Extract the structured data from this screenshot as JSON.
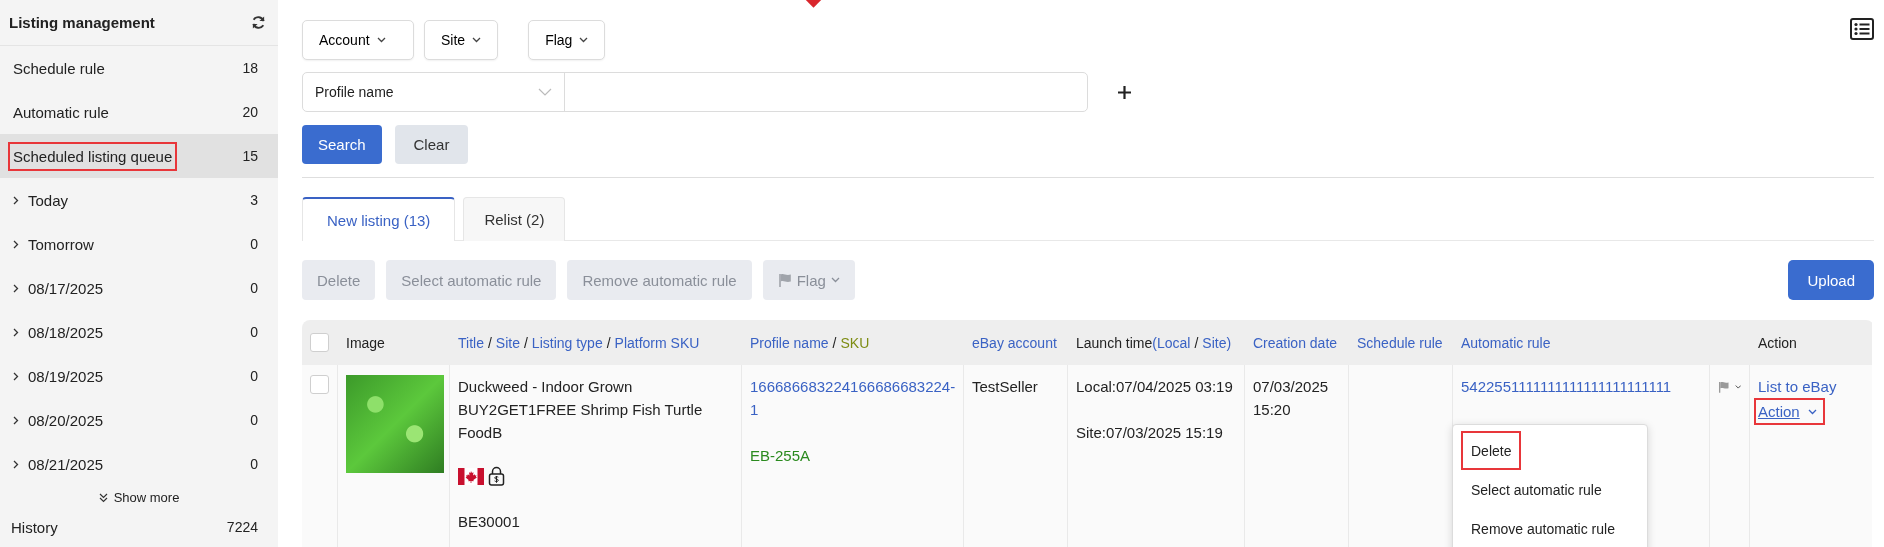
{
  "sidebar": {
    "title": "Listing management",
    "items": [
      {
        "label": "Schedule rule",
        "count": "18",
        "kind": "plain",
        "selected": false,
        "highlighted": false
      },
      {
        "label": "Automatic rule",
        "count": "20",
        "kind": "plain",
        "selected": false,
        "highlighted": false
      },
      {
        "label": "Scheduled listing queue",
        "count": "15",
        "kind": "plain",
        "selected": true,
        "highlighted": true
      },
      {
        "label": "Today",
        "count": "3",
        "kind": "group",
        "expanded": false,
        "selected": false,
        "highlighted": false
      },
      {
        "label": "Tomorrow",
        "count": "0",
        "kind": "group",
        "expanded": false,
        "selected": false,
        "highlighted": false
      },
      {
        "label": "08/17/2025",
        "count": "0",
        "kind": "group",
        "expanded": false,
        "selected": false,
        "highlighted": false
      },
      {
        "label": "08/18/2025",
        "count": "0",
        "kind": "group",
        "expanded": false,
        "selected": false,
        "highlighted": false
      },
      {
        "label": "08/19/2025",
        "count": "0",
        "kind": "group",
        "expanded": false,
        "selected": false,
        "highlighted": false
      },
      {
        "label": "08/20/2025",
        "count": "0",
        "kind": "group",
        "expanded": false,
        "selected": false,
        "highlighted": false
      },
      {
        "label": "08/21/2025",
        "count": "0",
        "kind": "group",
        "expanded": false,
        "selected": false,
        "highlighted": false
      }
    ],
    "show_more": "Show more",
    "history": {
      "label": "History",
      "count": "7224"
    }
  },
  "filters": {
    "dropdowns": [
      {
        "label": "Account"
      },
      {
        "label": "Site"
      },
      {
        "label": "Flag"
      }
    ],
    "search_field": {
      "selector": "Profile name"
    },
    "buttons": [
      {
        "label": "Search",
        "kind": "primary"
      },
      {
        "label": "Clear",
        "kind": "secondary"
      }
    ]
  },
  "tabs": [
    {
      "label": "New listing (13)",
      "selected": true
    },
    {
      "label": "Relist (2)",
      "selected": false
    }
  ],
  "toolbar": {
    "buttons": [
      {
        "label": "Delete",
        "kind": "plain",
        "disabled": true
      },
      {
        "label": "Select automatic rule",
        "kind": "plain",
        "disabled": true
      },
      {
        "label": "Remove automatic rule",
        "kind": "plain",
        "disabled": true
      },
      {
        "label": "Flag",
        "kind": "flag",
        "disabled": true
      }
    ],
    "upload": {
      "label": "Upload"
    }
  },
  "table": {
    "header_checked": false,
    "columns": [
      {
        "parts": [
          {
            "text": "Image",
            "kind": "plain"
          }
        ]
      },
      {
        "parts": [
          {
            "text": "Title",
            "kind": "link"
          },
          {
            "text": "/",
            "kind": "sep"
          },
          {
            "text": "Site",
            "kind": "link"
          },
          {
            "text": "/",
            "kind": "sep"
          },
          {
            "text": "Listing type",
            "kind": "link"
          },
          {
            "text": "/",
            "kind": "sep"
          },
          {
            "text": "Platform SKU",
            "kind": "link"
          }
        ]
      },
      {
        "parts": [
          {
            "text": "Profile name",
            "kind": "link"
          },
          {
            "text": "/",
            "kind": "sep"
          },
          {
            "text": "SKU",
            "kind": "sku"
          }
        ]
      },
      {
        "parts": [
          {
            "text": "eBay account",
            "kind": "link"
          }
        ]
      },
      {
        "parts": [
          {
            "text": "Launch time",
            "kind": "plain"
          },
          {
            "text": "(Local",
            "kind": "link"
          },
          {
            "text": "/",
            "kind": "sep"
          },
          {
            "text": "Site)",
            "kind": "link"
          }
        ]
      },
      {
        "parts": [
          {
            "text": "Creation date",
            "kind": "link"
          }
        ]
      },
      {
        "parts": [
          {
            "text": "Schedule rule",
            "kind": "link"
          }
        ]
      },
      {
        "parts": [
          {
            "text": "Automatic rule",
            "kind": "link"
          }
        ]
      },
      {
        "parts": [
          {
            "text": "Action",
            "kind": "plain"
          }
        ]
      }
    ],
    "rows": [
      {
        "checked": false,
        "title": "Duckweed - Indoor Grown BUY2GET1FREE Shrimp Fish Turtle FoodB",
        "platform_sku": "BE30001",
        "profile_name": "166686683224166686683224-1",
        "sku": "EB-255A",
        "ebay_account": "TestSeller",
        "launch_local": "Local:07/04/2025 03:19",
        "launch_site": "Site:07/03/2025 15:19",
        "creation_date": "07/03/2025 15:20",
        "automatic_rule": "5422551111111111111111111111",
        "actions": [
          {
            "label": "List to eBay",
            "kind": "link"
          },
          {
            "label": "Action",
            "kind": "dropdown",
            "highlighted": true
          }
        ]
      }
    ]
  },
  "action_menu": {
    "items": [
      {
        "label": "Delete",
        "highlighted": true
      },
      {
        "label": "Select automatic rule",
        "highlighted": false
      },
      {
        "label": "Remove automatic rule",
        "highlighted": false
      }
    ]
  }
}
